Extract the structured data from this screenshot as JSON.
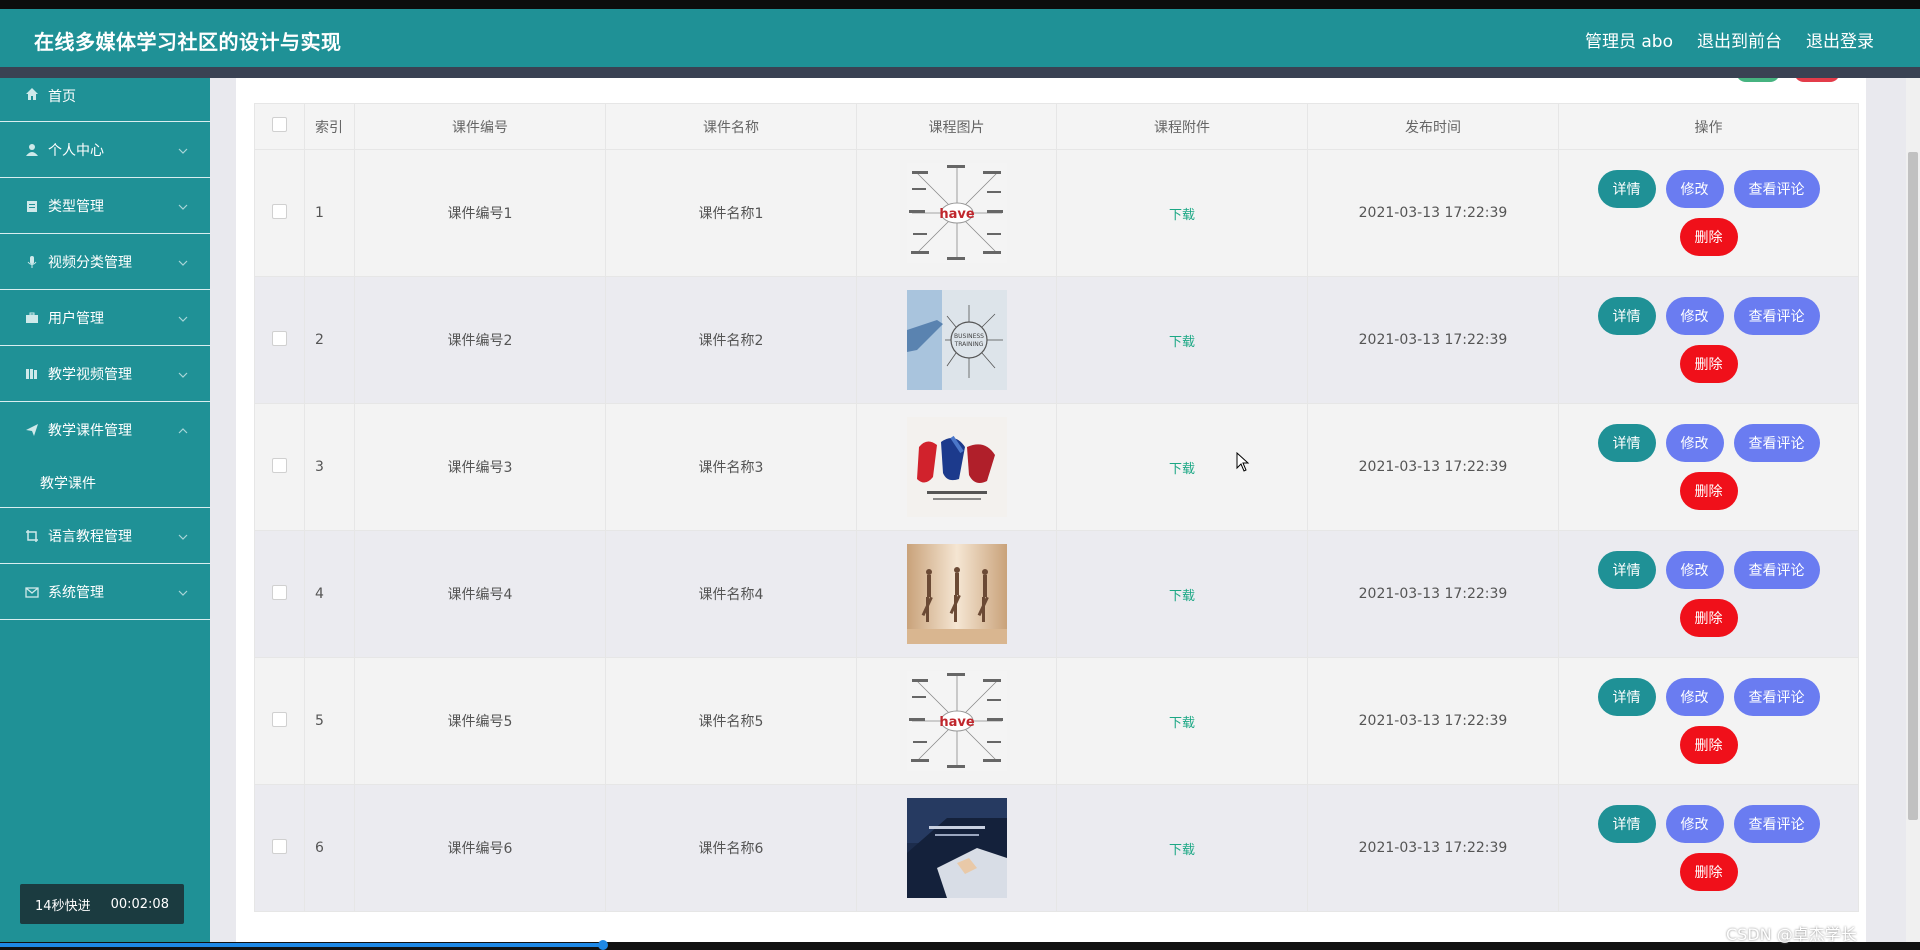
{
  "app": {
    "title": "在线多媒体学习社区的设计与实现",
    "user_label": "管理员 abo",
    "back_to_front": "退出到前台",
    "logout": "退出登录"
  },
  "sidebar": {
    "items": [
      {
        "label": "首页",
        "icon": "home-icon"
      },
      {
        "label": "个人中心",
        "icon": "user-icon"
      },
      {
        "label": "类型管理",
        "icon": "clipboard-icon"
      },
      {
        "label": "视频分类管理",
        "icon": "microphone-icon"
      },
      {
        "label": "用户管理",
        "icon": "briefcase-icon"
      },
      {
        "label": "教学视频管理",
        "icon": "book-icon"
      },
      {
        "label": "教学课件管理",
        "icon": "send-icon",
        "expanded": true,
        "children": [
          "教学课件"
        ]
      },
      {
        "label": "语言教程管理",
        "icon": "crop-icon"
      },
      {
        "label": "系统管理",
        "icon": "mail-icon"
      }
    ]
  },
  "table": {
    "columns": [
      "索引",
      "课件编号",
      "课件名称",
      "课程图片",
      "课程附件",
      "发布时间",
      "操作"
    ],
    "rows": [
      {
        "index": "1",
        "code": "课件编号1",
        "name": "课件名称1",
        "image": "have-wordmap",
        "attachment": "下载",
        "time": "2021-03-13 17:22:39"
      },
      {
        "index": "2",
        "code": "课件编号2",
        "name": "课件名称2",
        "image": "business-training",
        "attachment": "下载",
        "time": "2021-03-13 17:22:39"
      },
      {
        "index": "3",
        "code": "课件编号3",
        "name": "课件名称3",
        "image": "jianshencao",
        "attachment": "下载",
        "time": "2021-03-13 17:22:39"
      },
      {
        "index": "4",
        "code": "课件编号4",
        "name": "课件名称4",
        "image": "dancers",
        "attachment": "下载",
        "time": "2021-03-13 17:22:39"
      },
      {
        "index": "5",
        "code": "课件编号5",
        "name": "课件名称5",
        "image": "have-wordmap",
        "attachment": "下载",
        "time": "2021-03-13 17:22:39"
      },
      {
        "index": "6",
        "code": "课件编号6",
        "name": "课件名称6",
        "image": "business-man",
        "attachment": "下载",
        "time": "2021-03-13 17:22:39"
      }
    ],
    "actions": {
      "detail": "详情",
      "edit": "修改",
      "comments": "查看评论",
      "delete": "删除"
    }
  },
  "video_timer": {
    "skip_label": "14秒快进",
    "time": "00:02:08"
  },
  "watermark": "CSDN @卓杰学长",
  "colors": {
    "primary": "#1f9196",
    "header_bar": "#3a4253",
    "edit": "#6a7cf1",
    "delete": "#f0101a",
    "download": "#1ba784"
  }
}
